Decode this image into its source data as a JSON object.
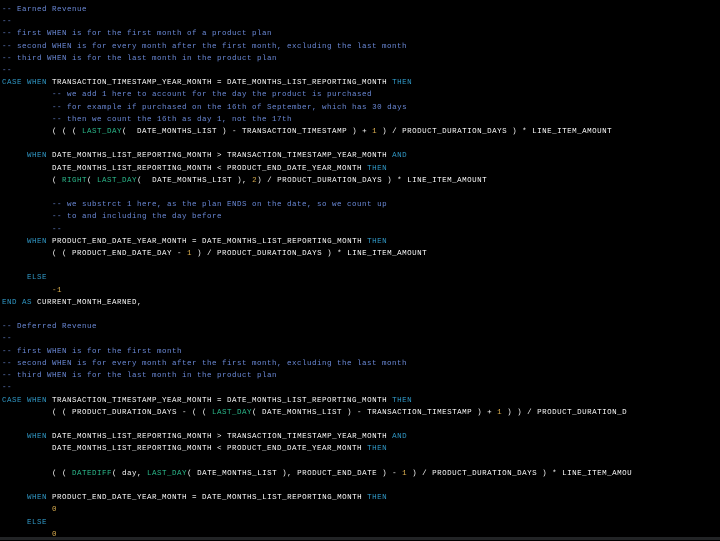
{
  "lines": [
    [
      {
        "c": "cm",
        "t": "-- Earned Revenue"
      }
    ],
    [
      {
        "c": "cm",
        "t": "--"
      }
    ],
    [
      {
        "c": "cm",
        "t": "-- first WHEN is for the first month of a product plan"
      }
    ],
    [
      {
        "c": "cm",
        "t": "-- second WHEN is for every month after the first month, excluding the last month"
      }
    ],
    [
      {
        "c": "cm",
        "t": "-- third WHEN is for the last month in the product plan"
      }
    ],
    [
      {
        "c": "cm",
        "t": "--"
      }
    ],
    [
      {
        "c": "kw",
        "t": "CASE WHEN"
      },
      {
        "c": "id",
        "t": " TRANSACTION_TIMESTAMP_YEAR_MONTH = DATE_MONTHS_LIST_REPORTING_MONTH "
      },
      {
        "c": "kw",
        "t": "THEN"
      }
    ],
    [
      {
        "c": "pn",
        "t": "          "
      },
      {
        "c": "cm",
        "t": "-- we add 1 here to account for the day the product is purchased"
      }
    ],
    [
      {
        "c": "pn",
        "t": "          "
      },
      {
        "c": "cm",
        "t": "-- for example if purchased on the 16th of September, which has 30 days"
      }
    ],
    [
      {
        "c": "pn",
        "t": "          "
      },
      {
        "c": "cm",
        "t": "-- then we count the 16th as day 1, not the 17th"
      }
    ],
    [
      {
        "c": "pn",
        "t": "          ( ( ( "
      },
      {
        "c": "fn",
        "t": "LAST_DAY"
      },
      {
        "c": "pn",
        "t": "(  DATE_MONTHS_LIST ) - TRANSACTION_TIMESTAMP ) + "
      },
      {
        "c": "nm",
        "t": "1"
      },
      {
        "c": "pn",
        "t": " ) / PRODUCT_DURATION_DAYS ) * LINE_ITEM_AMOUNT"
      }
    ],
    [],
    [
      {
        "c": "pn",
        "t": "     "
      },
      {
        "c": "kw",
        "t": "WHEN"
      },
      {
        "c": "id",
        "t": " DATE_MONTHS_LIST_REPORTING_MONTH > TRANSACTION_TIMESTAMP_YEAR_MONTH "
      },
      {
        "c": "kw",
        "t": "AND"
      }
    ],
    [
      {
        "c": "pn",
        "t": "          "
      },
      {
        "c": "id",
        "t": "DATE_MONTHS_LIST_REPORTING_MONTH < PRODUCT_END_DATE_YEAR_MONTH "
      },
      {
        "c": "kw",
        "t": "THEN"
      }
    ],
    [
      {
        "c": "pn",
        "t": "          ( "
      },
      {
        "c": "fn",
        "t": "RIGHT"
      },
      {
        "c": "pn",
        "t": "( "
      },
      {
        "c": "fn",
        "t": "LAST_DAY"
      },
      {
        "c": "pn",
        "t": "(  DATE_MONTHS_LIST ), "
      },
      {
        "c": "nm",
        "t": "2"
      },
      {
        "c": "pn",
        "t": ") / PRODUCT_DURATION_DAYS ) * LINE_ITEM_AMOUNT"
      }
    ],
    [],
    [
      {
        "c": "pn",
        "t": "          "
      },
      {
        "c": "cm",
        "t": "-- we substrct 1 here, as the plan ENDS on the date, so we count up"
      }
    ],
    [
      {
        "c": "pn",
        "t": "          "
      },
      {
        "c": "cm",
        "t": "-- to and including the day before"
      }
    ],
    [
      {
        "c": "pn",
        "t": "          "
      },
      {
        "c": "cm",
        "t": "--"
      }
    ],
    [
      {
        "c": "pn",
        "t": "     "
      },
      {
        "c": "kw",
        "t": "WHEN"
      },
      {
        "c": "id",
        "t": " PRODUCT_END_DATE_YEAR_MONTH = DATE_MONTHS_LIST_REPORTING_MONTH "
      },
      {
        "c": "kw",
        "t": "THEN"
      }
    ],
    [
      {
        "c": "pn",
        "t": "          ( ( PRODUCT_END_DATE_DAY - "
      },
      {
        "c": "nm",
        "t": "1"
      },
      {
        "c": "pn",
        "t": " ) / PRODUCT_DURATION_DAYS ) * LINE_ITEM_AMOUNT"
      }
    ],
    [],
    [
      {
        "c": "pn",
        "t": "     "
      },
      {
        "c": "kw",
        "t": "ELSE"
      }
    ],
    [
      {
        "c": "pn",
        "t": "          "
      },
      {
        "c": "nm",
        "t": "-1"
      }
    ],
    [
      {
        "c": "kw",
        "t": "END AS"
      },
      {
        "c": "id",
        "t": " CURRENT_MONTH_EARNED,"
      }
    ],
    [],
    [
      {
        "c": "cm",
        "t": "-- Deferred Revenue"
      }
    ],
    [
      {
        "c": "cm",
        "t": "--"
      }
    ],
    [
      {
        "c": "cm",
        "t": "-- first WHEN is for the first month"
      }
    ],
    [
      {
        "c": "cm",
        "t": "-- second WHEN is for every month after the first month, excluding the last month"
      }
    ],
    [
      {
        "c": "cm",
        "t": "-- third WHEN is for the last month in the product plan"
      }
    ],
    [
      {
        "c": "cm",
        "t": "--"
      }
    ],
    [
      {
        "c": "kw",
        "t": "CASE WHEN"
      },
      {
        "c": "id",
        "t": " TRANSACTION_TIMESTAMP_YEAR_MONTH = DATE_MONTHS_LIST_REPORTING_MONTH "
      },
      {
        "c": "kw",
        "t": "THEN"
      }
    ],
    [
      {
        "c": "pn",
        "t": "          ( ( PRODUCT_DURATION_DAYS - ( ( "
      },
      {
        "c": "fn",
        "t": "LAST_DAY"
      },
      {
        "c": "pn",
        "t": "( DATE_MONTHS_LIST ) - TRANSACTION_TIMESTAMP ) + "
      },
      {
        "c": "nm",
        "t": "1"
      },
      {
        "c": "pn",
        "t": " ) ) / PRODUCT_DURATION_D"
      }
    ],
    [],
    [
      {
        "c": "pn",
        "t": "     "
      },
      {
        "c": "kw",
        "t": "WHEN"
      },
      {
        "c": "id",
        "t": " DATE_MONTHS_LIST_REPORTING_MONTH > TRANSACTION_TIMESTAMP_YEAR_MONTH "
      },
      {
        "c": "kw",
        "t": "AND"
      }
    ],
    [
      {
        "c": "pn",
        "t": "          "
      },
      {
        "c": "id",
        "t": "DATE_MONTHS_LIST_REPORTING_MONTH < PRODUCT_END_DATE_YEAR_MONTH "
      },
      {
        "c": "kw",
        "t": "THEN"
      }
    ],
    [],
    [
      {
        "c": "pn",
        "t": "          ( ( "
      },
      {
        "c": "fn",
        "t": "DATEDIFF"
      },
      {
        "c": "pn",
        "t": "( day, "
      },
      {
        "c": "fn",
        "t": "LAST_DAY"
      },
      {
        "c": "pn",
        "t": "( DATE_MONTHS_LIST ), PRODUCT_END_DATE ) - "
      },
      {
        "c": "nm",
        "t": "1"
      },
      {
        "c": "pn",
        "t": " ) / PRODUCT_DURATION_DAYS ) * LINE_ITEM_AMOU"
      }
    ],
    [],
    [
      {
        "c": "pn",
        "t": "     "
      },
      {
        "c": "kw",
        "t": "WHEN"
      },
      {
        "c": "id",
        "t": " PRODUCT_END_DATE_YEAR_MONTH = DATE_MONTHS_LIST_REPORTING_MONTH "
      },
      {
        "c": "kw",
        "t": "THEN"
      }
    ],
    [
      {
        "c": "pn",
        "t": "          "
      },
      {
        "c": "nm",
        "t": "0"
      }
    ],
    [
      {
        "c": "pn",
        "t": "     "
      },
      {
        "c": "kw",
        "t": "ELSE"
      }
    ],
    [
      {
        "c": "pn",
        "t": "          "
      },
      {
        "c": "nm",
        "t": "0"
      }
    ]
  ]
}
